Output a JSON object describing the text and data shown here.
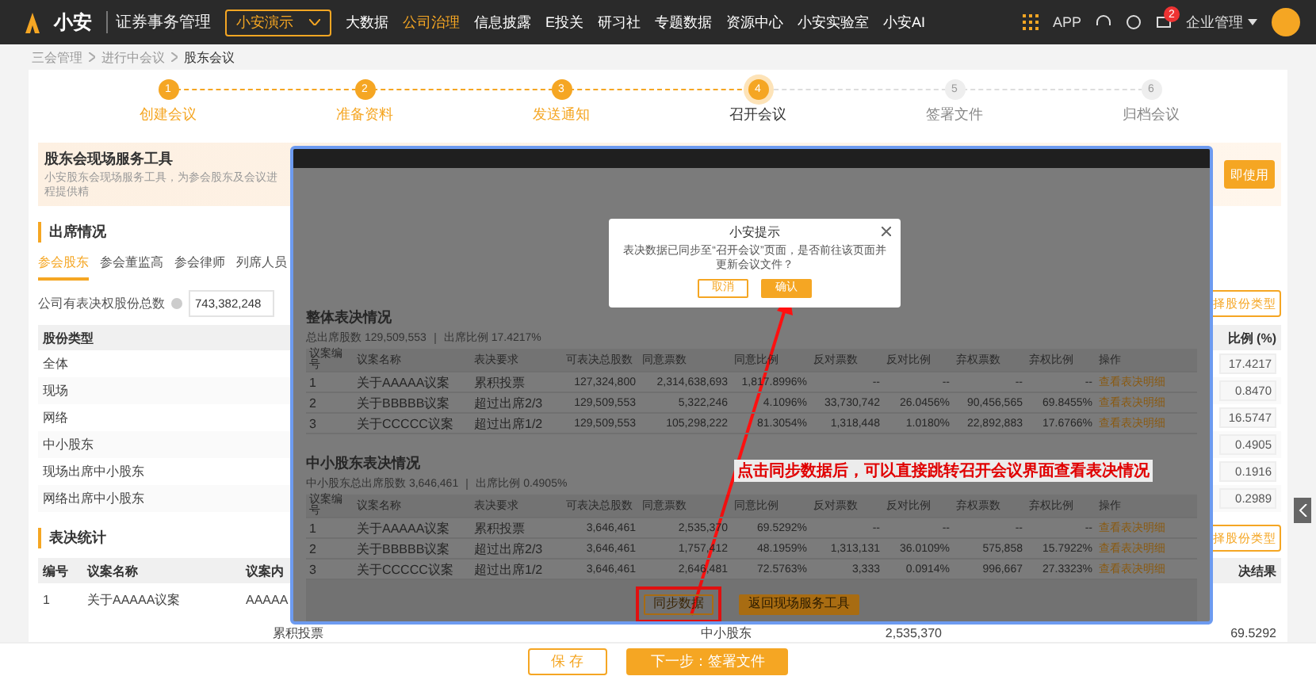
{
  "nav": {
    "logo": "小安",
    "product": "证券事务管理",
    "company": "小安演示",
    "items": [
      {
        "label": "大数据",
        "selected": false
      },
      {
        "label": "公司治理",
        "selected": true
      },
      {
        "label": "信息披露",
        "selected": false
      },
      {
        "label": "E投关",
        "selected": false
      },
      {
        "label": "研习社",
        "selected": false
      },
      {
        "label": "专题数据",
        "selected": false
      },
      {
        "label": "资源中心",
        "selected": false
      },
      {
        "label": "小安实验室",
        "selected": false
      },
      {
        "label": "小安AI",
        "selected": false
      }
    ],
    "app": "APP",
    "notification_count": "2",
    "account": "企业管理"
  },
  "breadcrumb": [
    "三会管理",
    "进行中会议",
    "股东会议"
  ],
  "steps": [
    {
      "number": "1",
      "label": "创建会议",
      "completed": true,
      "selected": false
    },
    {
      "number": "2",
      "label": "准备资料",
      "completed": true,
      "selected": false
    },
    {
      "number": "3",
      "label": "发送通知",
      "completed": true,
      "selected": false
    },
    {
      "number": "4",
      "label": "召开会议",
      "completed": false,
      "selected": true
    },
    {
      "number": "5",
      "label": "签署文件",
      "completed": false,
      "selected": false
    },
    {
      "number": "6",
      "label": "归档会议",
      "completed": false,
      "selected": false
    }
  ],
  "banner": {
    "title": "股东会现场服务工具",
    "subtitle": "小安股东会现场服务工具，为参会股东及会议进程提供精",
    "button": "即使用"
  },
  "attendance": {
    "title": "出席情况",
    "tabs": [
      {
        "label": "参会股东",
        "selected": true
      },
      {
        "label": "参会董监高",
        "selected": false
      },
      {
        "label": "参会律师",
        "selected": false
      },
      {
        "label": "列席人员",
        "selected": false
      }
    ],
    "total_label": "公司有表决权股份总数",
    "total_value": "743,382,248",
    "type_button": "择股份类型",
    "columns": [
      "股份类型",
      "比例 (%)"
    ],
    "rows": [
      {
        "type": "全体",
        "ratio": "17.4217"
      },
      {
        "type": "现场",
        "ratio": "0.8470"
      },
      {
        "type": "网络",
        "ratio": "16.5747"
      },
      {
        "type": "中小股东",
        "ratio": "0.4905"
      },
      {
        "type": "现场出席中小股东",
        "ratio": "0.1916"
      },
      {
        "type": "网络出席中小股东",
        "ratio": "0.2989"
      }
    ]
  },
  "voting": {
    "title": "表决统计",
    "type_button": "择股份类型",
    "columns": [
      "编号",
      "议案名称",
      "议案内",
      "决结果"
    ],
    "rows": [
      [
        "1",
        "关于AAAAA议案",
        "AAAAA"
      ]
    ],
    "partial_row": [
      "累积投票",
      "中小股东",
      "2,535,370",
      "69.5292"
    ]
  },
  "footer": {
    "buttons": [
      {
        "label": "保 存",
        "kind": "secondary"
      },
      {
        "label": "下一步：签署文件",
        "kind": "primary"
      }
    ]
  },
  "screenshot": {
    "sections": [
      {
        "title": "整体表决情况",
        "stats": [
          {
            "label": "总出席股数",
            "value": "129,509,553"
          },
          {
            "label": "出席比例",
            "value": "17.4217%"
          }
        ],
        "columns": [
          "议案编号",
          "议案名称",
          "表决要求",
          "可表决总股数",
          "同意票数",
          "同意比例",
          "反对票数",
          "反对比例",
          "弃权票数",
          "弃权比例",
          "操作"
        ],
        "rows": [
          [
            "1",
            "关于AAAAA议案",
            "累积投票",
            "127,324,800",
            "2,314,638,693",
            "1,817.8996%",
            "--",
            "--",
            "--",
            "--",
            "查看表决明细"
          ],
          [
            "2",
            "关于BBBBB议案",
            "超过出席2/3",
            "129,509,553",
            "5,322,246",
            "4.1096%",
            "33,730,742",
            "26.0456%",
            "90,456,565",
            "69.8455%",
            "查看表决明细"
          ],
          [
            "3",
            "关于CCCCC议案",
            "超过出席1/2",
            "129,509,553",
            "105,298,222",
            "81.3054%",
            "1,318,448",
            "1.0180%",
            "22,892,883",
            "17.6766%",
            "查看表决明细"
          ]
        ]
      },
      {
        "title": "中小股东表决情况",
        "stats": [
          {
            "label": "中小股东总出席股数",
            "value": "3,646,461"
          },
          {
            "label": "出席比例",
            "value": "0.4905%"
          }
        ],
        "columns": [
          "议案编号",
          "议案名称",
          "表决要求",
          "可表决总股数",
          "同意票数",
          "同意比例",
          "反对票数",
          "反对比例",
          "弃权票数",
          "弃权比例",
          "操作"
        ],
        "rows": [
          [
            "1",
            "关于AAAAA议案",
            "累积投票",
            "3,646,461",
            "2,535,370",
            "69.5292%",
            "--",
            "--",
            "--",
            "--",
            "查看表决明细"
          ],
          [
            "2",
            "关于BBBBB议案",
            "超过出席2/3",
            "3,646,461",
            "1,757,412",
            "48.1959%",
            "1,313,131",
            "36.0109%",
            "575,858",
            "15.7922%",
            "查看表决明细"
          ],
          [
            "3",
            "关于CCCCC议案",
            "超过出席1/2",
            "3,646,461",
            "2,646,481",
            "72.5763%",
            "3,333",
            "0.0914%",
            "996,667",
            "27.3323%",
            "查看表决明细"
          ]
        ]
      }
    ],
    "dialog": {
      "title": "小安提示",
      "message": "表决数据已同步至“召开会议”页面，是否前往该页面并更新会议文件？",
      "buttons": [
        {
          "label": "取消",
          "kind": "secondary"
        },
        {
          "label": "确认",
          "kind": "primary"
        }
      ]
    },
    "buttons": [
      {
        "label": "同步数据",
        "kind": "secondary",
        "highlighted": true
      },
      {
        "label": "返回现场服务工具",
        "kind": "primary",
        "highlighted": false
      }
    ]
  },
  "annotation": {
    "text": "点击同步数据后，可以直接跳转召开会议界面查看表决情况"
  }
}
